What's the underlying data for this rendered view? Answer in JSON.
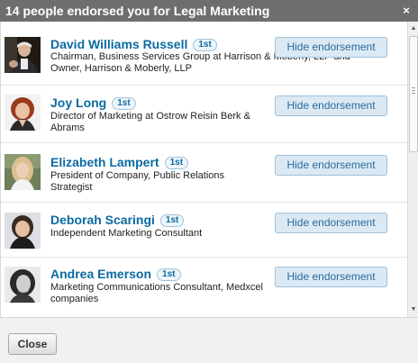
{
  "dialog": {
    "title": "14 people endorsed you for Legal Marketing",
    "close_glyph": "×",
    "close_button_label": "Close"
  },
  "endorsers": [
    {
      "name": "David Williams Russell",
      "degree": "1st",
      "headline": "Chairman, Business Services Group at Harrison & Moberly, LLP and Owner, Harrison & Moberly, LLP",
      "action": "Hide endorsement"
    },
    {
      "name": "Joy Long",
      "degree": "1st",
      "headline": "Director of Marketing at Ostrow Reisin Berk & Abrams",
      "action": "Hide endorsement"
    },
    {
      "name": "Elizabeth Lampert",
      "degree": "1st",
      "headline": "President of Company, Public Relations Strategist",
      "action": "Hide endorsement"
    },
    {
      "name": "Deborah Scaringi",
      "degree": "1st",
      "headline": "Independent Marketing Consultant",
      "action": "Hide endorsement"
    },
    {
      "name": "Andrea Emerson",
      "degree": "1st",
      "headline": "Marketing Communications Consultant, Medxcel companies",
      "action": "Hide endorsement"
    }
  ],
  "scrollbar": {
    "up_icon": "scroll-up-arrow-icon",
    "down_icon": "scroll-down-arrow-icon",
    "up_glyph": "▲",
    "down_glyph": "▼"
  }
}
